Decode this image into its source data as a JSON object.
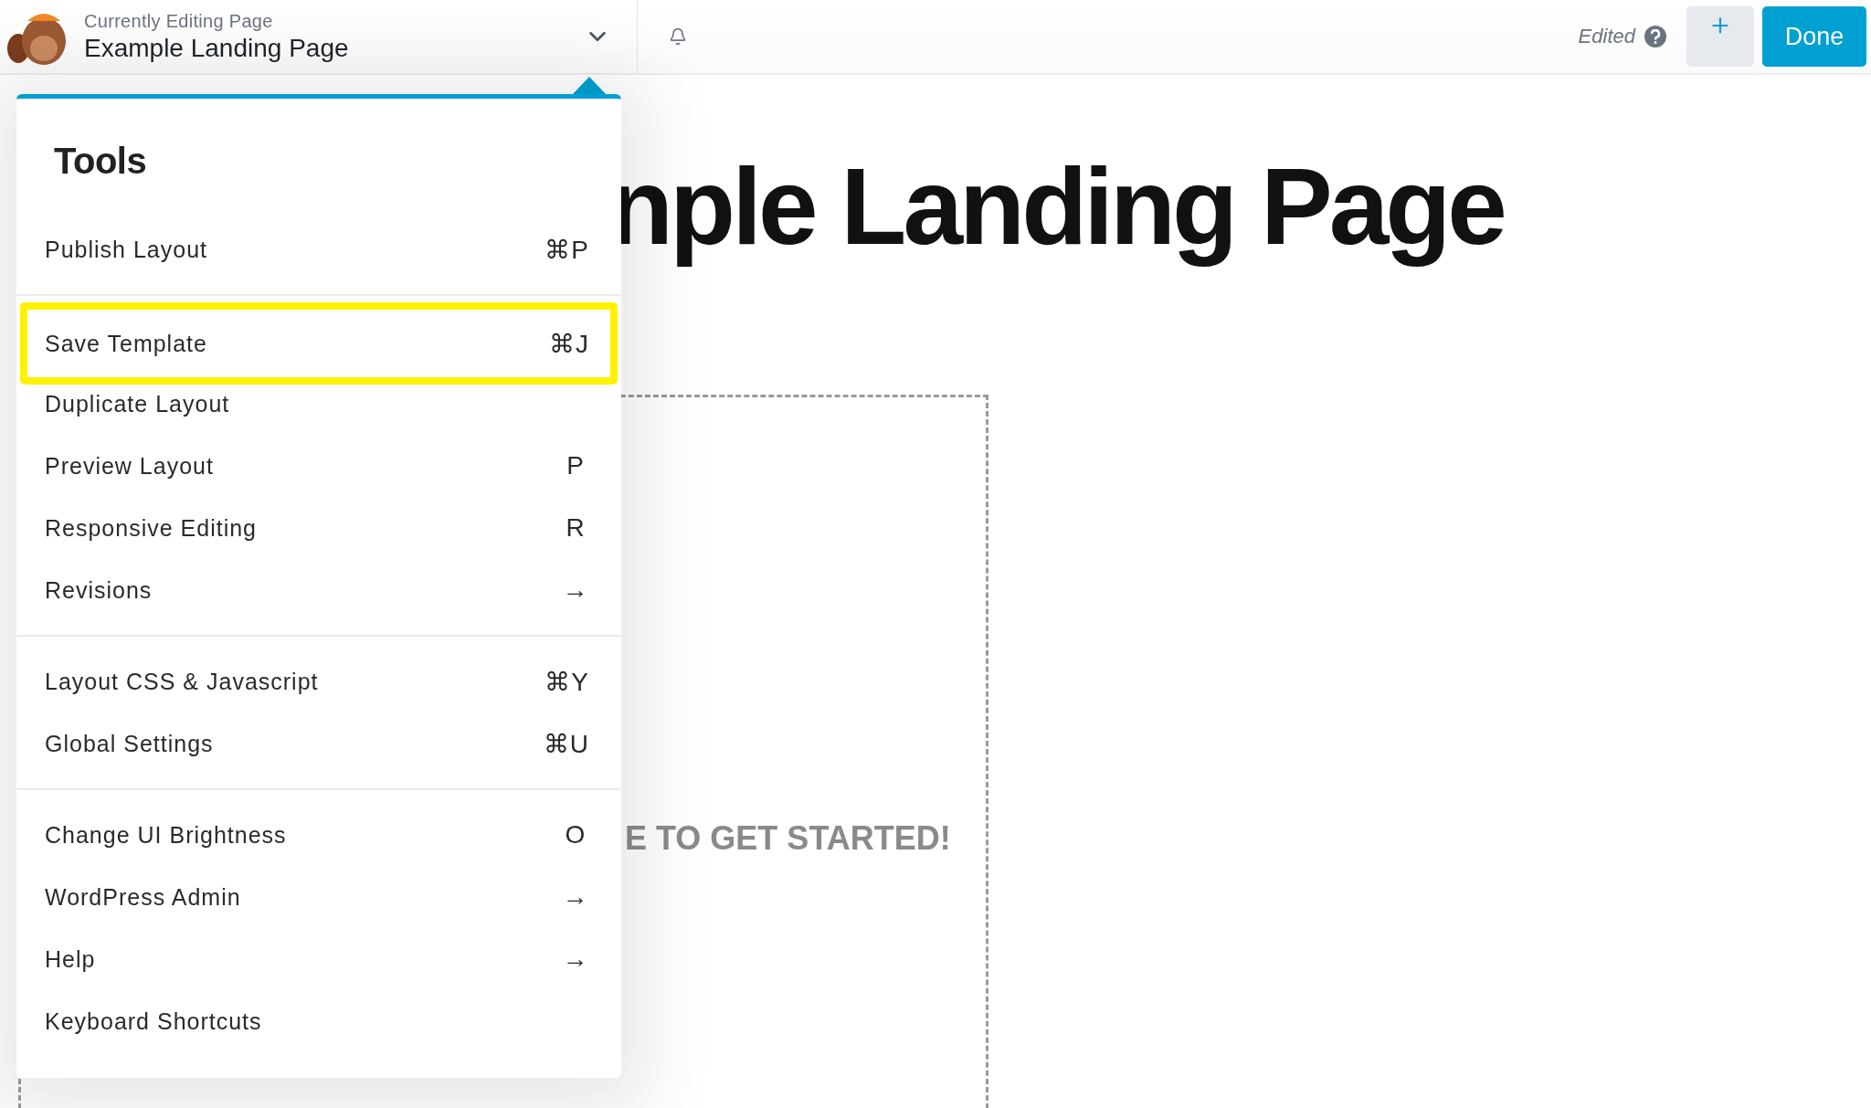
{
  "header": {
    "subtitle": "Currently Editing Page",
    "title": "Example Landing Page",
    "status": "Edited",
    "done_button": "Done"
  },
  "canvas": {
    "heading": "nple Landing Page",
    "prompt": "E TO GET STARTED!"
  },
  "menu": {
    "title": "Tools",
    "groups": [
      {
        "items": [
          {
            "label": "Publish Layout",
            "shortcut": "⌘P",
            "highlighted": false
          }
        ]
      },
      {
        "items": [
          {
            "label": "Save Template",
            "shortcut": "⌘J",
            "highlighted": true
          },
          {
            "label": "Duplicate Layout",
            "highlighted": false
          },
          {
            "label": "Preview Layout",
            "shortcut": "P",
            "highlighted": false
          },
          {
            "label": "Responsive Editing",
            "shortcut": "R",
            "highlighted": false
          },
          {
            "label": "Revisions",
            "shortcut": "→",
            "highlighted": false
          }
        ]
      },
      {
        "items": [
          {
            "label": "Layout CSS & Javascript",
            "shortcut": "⌘Y",
            "highlighted": false
          },
          {
            "label": "Global Settings",
            "shortcut": "⌘U",
            "highlighted": false
          }
        ]
      },
      {
        "items": [
          {
            "label": "Change UI Brightness",
            "shortcut": "O",
            "highlighted": false
          },
          {
            "label": "WordPress Admin",
            "shortcut": "→",
            "highlighted": false
          },
          {
            "label": "Help",
            "shortcut": "→",
            "highlighted": false
          },
          {
            "label": "Keyboard Shortcuts",
            "highlighted": false
          }
        ]
      }
    ]
  }
}
